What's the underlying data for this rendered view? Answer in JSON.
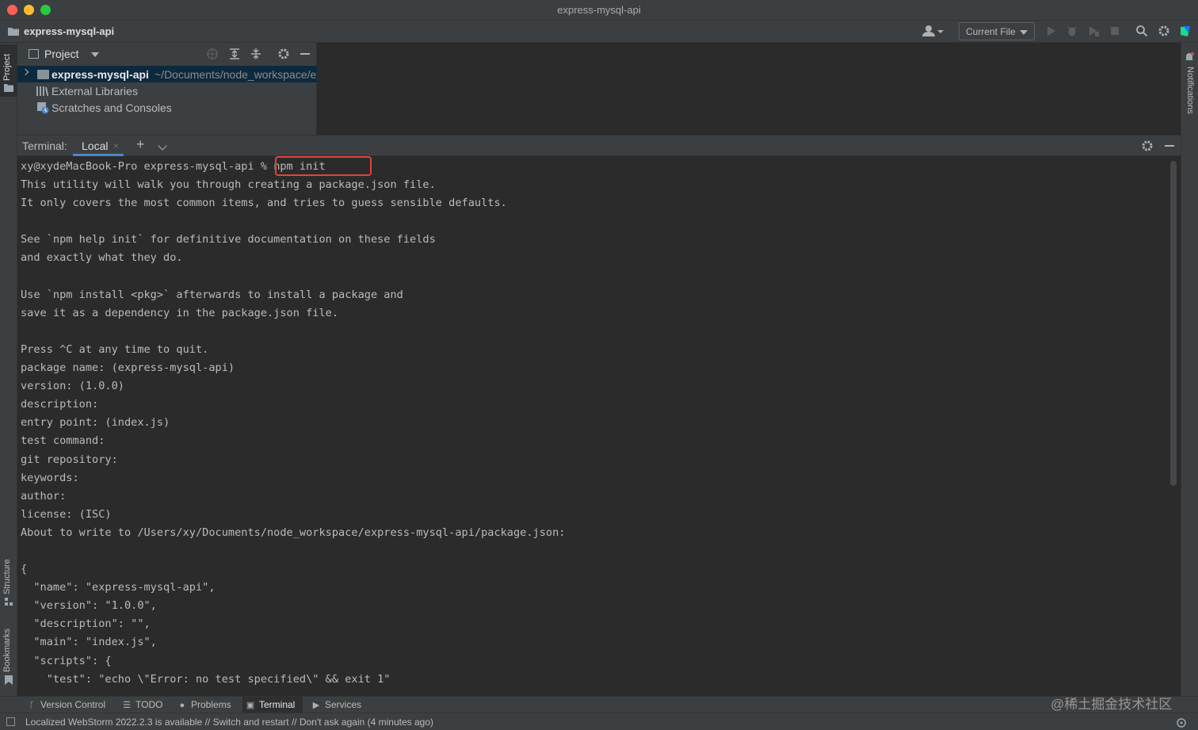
{
  "window": {
    "title": "express-mysql-api"
  },
  "navbar": {
    "project_name": "express-mysql-api",
    "run_config": "Current File"
  },
  "left_stripe": {
    "project_tab": "Project",
    "structure_tab": "Structure",
    "bookmarks_tab": "Bookmarks"
  },
  "right_stripe": {
    "notifications_tab": "Notifications"
  },
  "project_panel": {
    "title": "Project",
    "tree": [
      {
        "name": "express-mysql-api",
        "path": "~/Documents/node_workspace/ex"
      },
      {
        "name": "External Libraries"
      },
      {
        "name": "Scratches and Consoles"
      }
    ]
  },
  "terminal": {
    "label": "Terminal:",
    "tab": "Local",
    "tab_close": "×",
    "add": "+",
    "prompt": "xy@xydeMacBook-Pro express-mysql-api % ",
    "command": "npm init",
    "lines": [
      "This utility will walk you through creating a package.json file.",
      "It only covers the most common items, and tries to guess sensible defaults.",
      "",
      "See `npm help init` for definitive documentation on these fields",
      "and exactly what they do.",
      "",
      "Use `npm install <pkg>` afterwards to install a package and",
      "save it as a dependency in the package.json file.",
      "",
      "Press ^C at any time to quit.",
      "package name: (express-mysql-api)",
      "version: (1.0.0)",
      "description:",
      "entry point: (index.js)",
      "test command:",
      "git repository:",
      "keywords:",
      "author:",
      "license: (ISC)",
      "About to write to /Users/xy/Documents/node_workspace/express-mysql-api/package.json:",
      "",
      "{",
      "  \"name\": \"express-mysql-api\",",
      "  \"version\": \"1.0.0\",",
      "  \"description\": \"\",",
      "  \"main\": \"index.js\",",
      "  \"scripts\": {",
      "    \"test\": \"echo \\\"Error: no test specified\\\" && exit 1\""
    ]
  },
  "tool_windows": [
    {
      "label": "Version Control",
      "icon": "branch-icon"
    },
    {
      "label": "TODO",
      "icon": "list-icon"
    },
    {
      "label": "Problems",
      "icon": "info-icon"
    },
    {
      "label": "Terminal",
      "icon": "terminal-icon"
    },
    {
      "label": "Services",
      "icon": "play-icon"
    }
  ],
  "watermark": "@稀土掘金技术社区",
  "status": {
    "message": "Localized WebStorm 2022.2.3 is available // Switch and restart // Don't ask again (4 minutes ago)"
  },
  "colors": {
    "highlight_box": "#e0443e",
    "tab_underline": "#4a88c7",
    "background": "#2b2b2b",
    "panel": "#3c3f41"
  }
}
